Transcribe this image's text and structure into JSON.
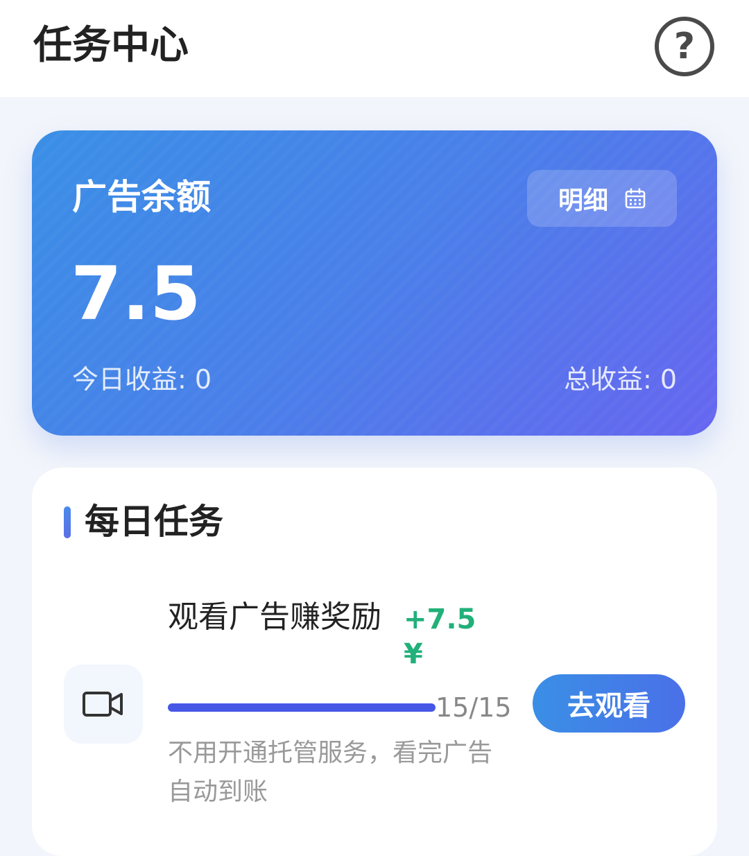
{
  "header": {
    "title": "任务中心",
    "help_glyph": "?"
  },
  "balance_card": {
    "title": "广告余额",
    "detail_label": "明细",
    "detail_icon": "calendar-icon",
    "balance": "7.5",
    "today_earnings": "今日收益: 0",
    "total_earnings": "总收益: 0",
    "gradient_colors": [
      "#3a8fe6",
      "#6666f0"
    ]
  },
  "daily_tasks": {
    "section_title": "每日任务",
    "tasks": [
      {
        "icon": "video-camera-icon",
        "name": "观看广告赚奖励",
        "reward": "+7.5 ¥",
        "progress_text": "15/15",
        "progress_fraction": 1.0,
        "button_label": "去观看",
        "description": "不用开通托管服务，看完广告自动到账"
      }
    ]
  },
  "colors": {
    "accent_blue": "#4a7fe9",
    "reward_green": "#21b07a",
    "progress_blue": "#4657e6"
  }
}
